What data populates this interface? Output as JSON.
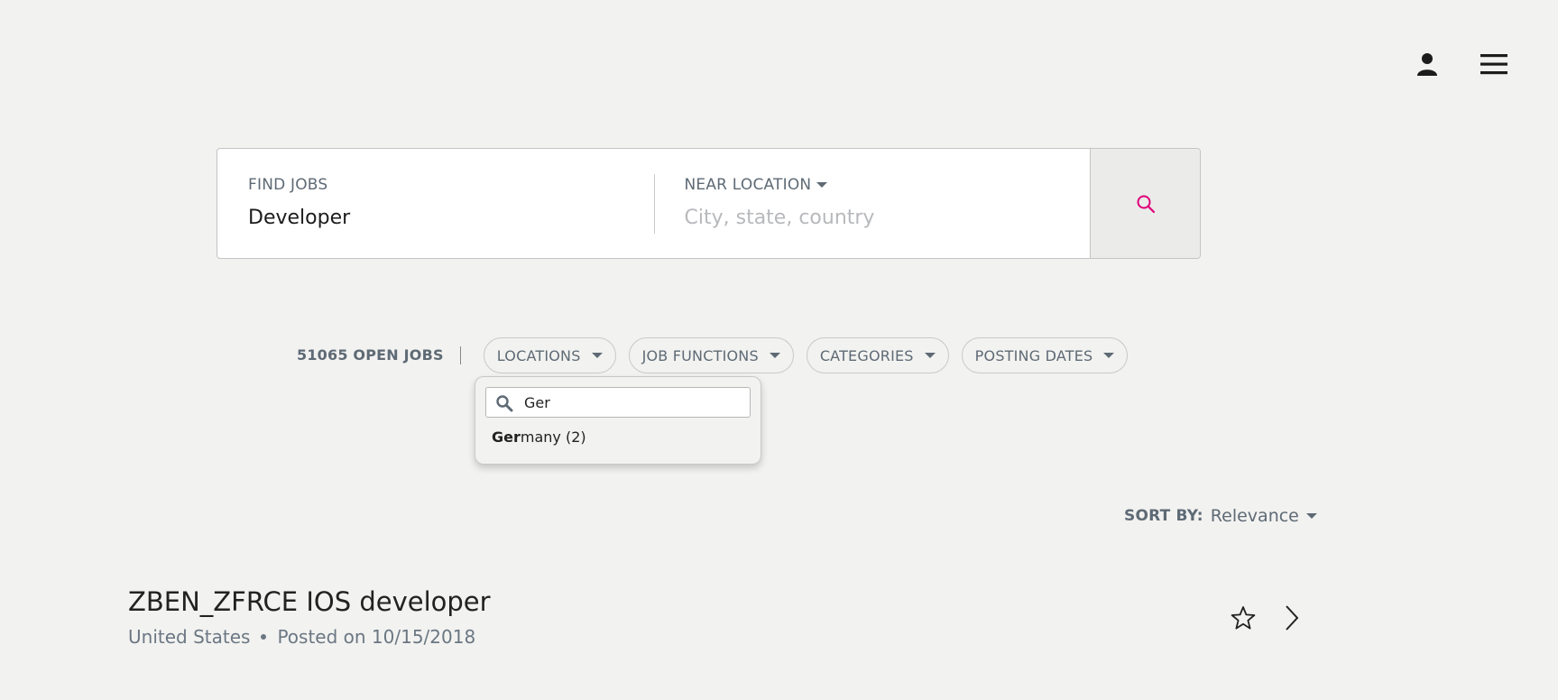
{
  "header": {
    "profile_icon": "user-icon",
    "menu_icon": "hamburger-icon"
  },
  "search": {
    "find_label": "FIND JOBS",
    "find_value": "Developer",
    "location_label": "NEAR LOCATION",
    "location_placeholder": "City, state, country",
    "button_icon": "search-icon",
    "accent_color": "#e0007a"
  },
  "filters": {
    "open_jobs": "51065 OPEN JOBS",
    "pills": [
      "LOCATIONS",
      "JOB FUNCTIONS",
      "CATEGORIES",
      "POSTING DATES"
    ]
  },
  "locations_dropdown": {
    "search_value": "Ger",
    "option_match": "Ger",
    "option_rest": "many (2)"
  },
  "sort": {
    "label": "SORT BY:",
    "value": "Relevance"
  },
  "job": {
    "title": "ZBEN_ZFRCE IOS developer",
    "location": "United States",
    "posted": "Posted on 10/15/2018"
  }
}
